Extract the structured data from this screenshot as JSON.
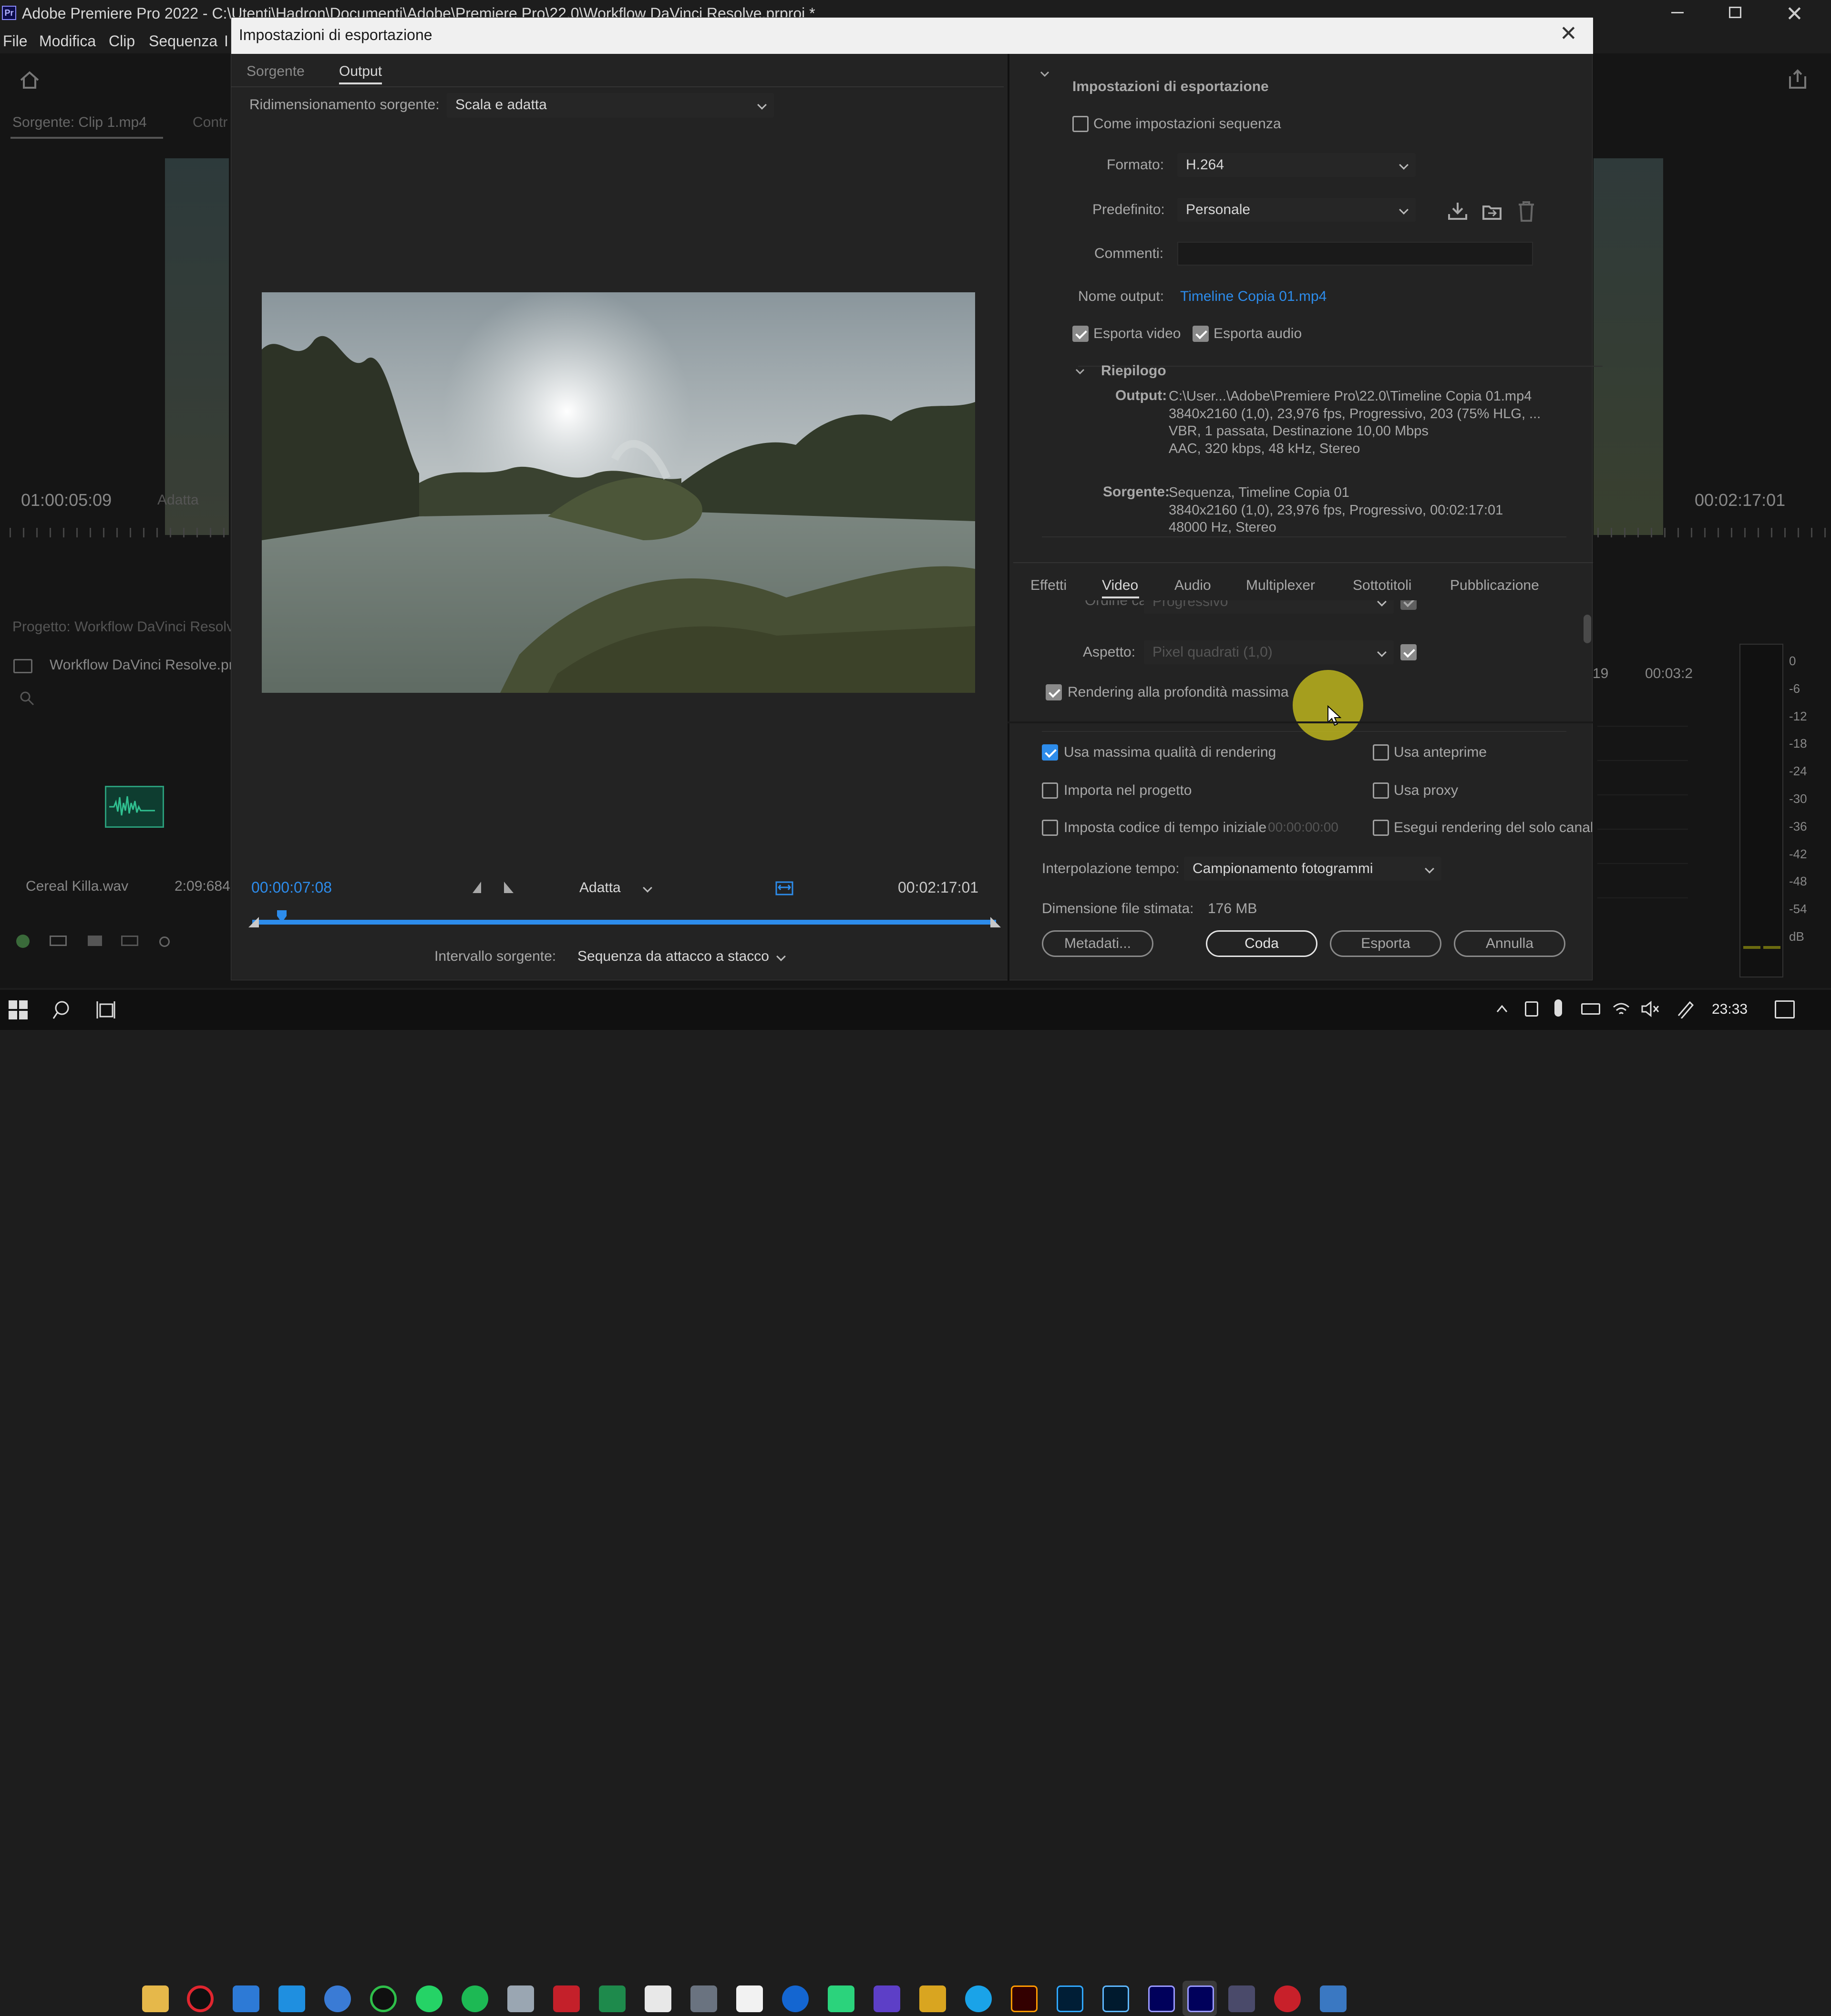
{
  "app": {
    "title": "Adobe Premiere Pro 2022 - C:\\Utenti\\Hadron\\Documenti\\Adobe\\Premiere Pro\\22.0\\Workflow DaVinci Resolve.prproj *",
    "menu": [
      "File",
      "Modifica",
      "Clip",
      "Sequenza",
      "I"
    ]
  },
  "bg": {
    "source_label": "Sorgente: Clip 1.mp4",
    "controls_tab": "Contr",
    "left_tc": "01:00:05:09",
    "left_fit": "Adatta",
    "right_tc": "00:02:17:01",
    "project_title": "Progetto: Workflow DaVinci Resolv",
    "project_file": "Workflow DaVinci Resolve.pr",
    "clip_name": "Cereal Killa.wav",
    "clip_dur": "2:09:684",
    "tl_19": "19",
    "tl_time": "00:03:2",
    "meter_ticks": [
      "0",
      "-6",
      "-12",
      "-18",
      "-24",
      "-30",
      "-36",
      "-42",
      "-48",
      "-54",
      "dB"
    ]
  },
  "dialog": {
    "title": "Impostazioni di esportazione",
    "tabs": [
      "Sorgente",
      "Output"
    ],
    "scaling_label": "Ridimensionamento sorgente:",
    "scaling_value": "Scala e adatta",
    "current_tc": "00:00:07:08",
    "fit_value": "Adatta",
    "end_tc": "00:02:17:01",
    "range_label": "Intervallo sorgente:",
    "range_value": "Sequenza da attacco a stacco",
    "settings": {
      "section": "Impostazioni di esportazione",
      "match_seq": "Come impostazioni sequenza",
      "format_label": "Formato:",
      "format_value": "H.264",
      "preset_label": "Predefinito:",
      "preset_value": "Personale",
      "comments_label": "Commenti:",
      "comments_value": "",
      "output_name_label": "Nome output:",
      "output_name_value": "Timeline Copia 01.mp4",
      "export_video": "Esporta video",
      "export_audio": "Esporta audio",
      "summary": {
        "title": "Riepilogo",
        "output_label": "Output:",
        "output_lines": [
          "C:\\User...\\Adobe\\Premiere Pro\\22.0\\Timeline Copia 01.mp4",
          "3840x2160 (1,0), 23,976 fps, Progressivo, 203 (75% HLG, ...",
          "VBR, 1 passata, Destinazione 10,00 Mbps",
          "AAC, 320 kbps, 48 kHz, Stereo"
        ],
        "source_label": "Sorgente:",
        "source_lines": [
          "Sequenza, Timeline Copia 01",
          "3840x2160 (1,0), 23,976 fps, Progressivo, 00:02:17:01",
          "48000 Hz, Stereo"
        ]
      }
    },
    "subtabs": [
      "Effetti",
      "Video",
      "Audio",
      "Multiplexer",
      "Sottotitoli",
      "Pubblicazione"
    ],
    "video": {
      "frame_partial": "Ordine campi:",
      "frame_value": "Progressivo",
      "aspect_label": "Aspetto:",
      "aspect_value": "Pixel quadrati (1,0)",
      "max_depth": "Rendering alla profondità massima"
    },
    "opts": {
      "max_quality": "Usa massima qualità di rendering",
      "use_previews": "Usa anteprime",
      "import_project": "Importa nel progetto",
      "use_proxy": "Usa proxy",
      "set_start_tc": "Imposta codice di tempo iniziale",
      "start_tc_value": "00:00:00:00",
      "alpha_only": "Esegui rendering del solo canale",
      "interp_label": "Interpolazione tempo:",
      "interp_value": "Campionamento fotogrammi",
      "size_label": "Dimensione file stimata:",
      "size_value": "176 MB"
    },
    "buttons": {
      "metadata": "Metadati...",
      "queue": "Coda",
      "export": "Esporta",
      "cancel": "Annulla"
    }
  },
  "taskbar": {
    "time": "23:33"
  }
}
